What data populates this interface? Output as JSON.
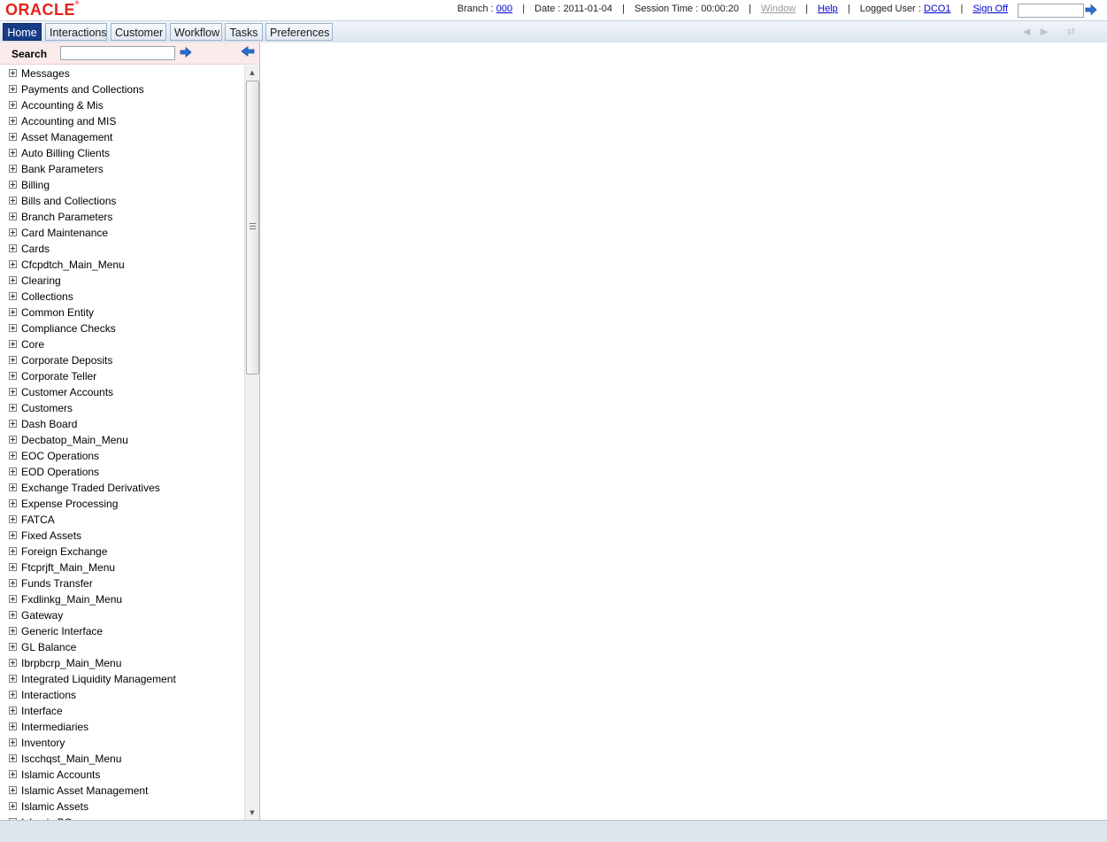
{
  "header": {
    "logo": "ORACLE",
    "branch_label": "Branch :",
    "branch_value": "000",
    "date_label": "Date :",
    "date_value": "2011-01-04",
    "session_label": "Session Time :",
    "session_value": "00:00:20",
    "window_link": "Window",
    "help_link": "Help",
    "user_label": "Logged User :",
    "user_value": "DCO1",
    "signoff_link": "Sign Off",
    "search_value": ""
  },
  "tabs": [
    {
      "label": "Home",
      "active": true
    },
    {
      "label": "Interactions"
    },
    {
      "label": "Customer"
    },
    {
      "label": "Workflow"
    },
    {
      "label": "Tasks"
    },
    {
      "label": "Preferences"
    }
  ],
  "sidebar": {
    "search_label": "Search",
    "search_value": "",
    "items": [
      "Messages",
      "Payments and Collections",
      "Accounting & Mis",
      "Accounting and MIS",
      "Asset Management",
      "Auto Billing Clients",
      "Bank Parameters",
      "Billing",
      "Bills and Collections",
      "Branch Parameters",
      "Card Maintenance",
      "Cards",
      "Cfcpdtch_Main_Menu",
      "Clearing",
      "Collections",
      "Common Entity",
      "Compliance Checks",
      "Core",
      "Corporate Deposits",
      "Corporate Teller",
      "Customer Accounts",
      "Customers",
      "Dash Board",
      "Decbatop_Main_Menu",
      "EOC Operations",
      "EOD Operations",
      "Exchange Traded Derivatives",
      "Expense Processing",
      "FATCA",
      "Fixed Assets",
      "Foreign Exchange",
      "Ftcprjft_Main_Menu",
      "Funds Transfer",
      "Fxdlinkg_Main_Menu",
      "Gateway",
      "Generic Interface",
      "GL Balance",
      "Ibrpbcrp_Main_Menu",
      "Integrated Liquidity Management",
      "Interactions",
      "Interface",
      "Intermediaries",
      "Inventory",
      "Iscchqst_Main_Menu",
      "Islamic Accounts",
      "Islamic Asset Management",
      "Islamic Assets",
      "Islamic BC"
    ]
  },
  "colors": {
    "tab_active": "#173d87",
    "logo_red": "#e2231a",
    "link_blue": "#0000cc"
  }
}
